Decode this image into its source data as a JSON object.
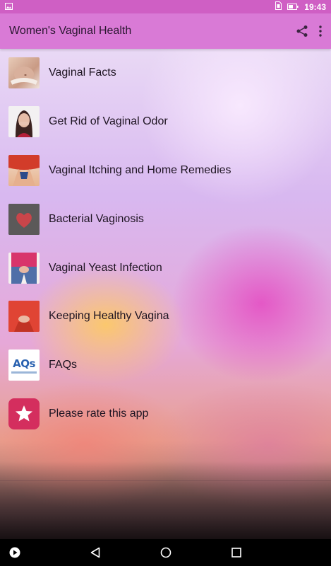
{
  "status_bar": {
    "time": "19:43",
    "icons": [
      "image-icon",
      "sim-icon",
      "battery-icon"
    ]
  },
  "app_bar": {
    "title": "Women's Vaginal Health",
    "actions": [
      "share-icon",
      "overflow-menu-icon"
    ],
    "color": "#d97ad6"
  },
  "menu": {
    "items": [
      {
        "label": "Vaginal Facts",
        "icon": "belly-thumbnail"
      },
      {
        "label": "Get Rid of Vaginal Odor",
        "icon": "woman-covering-face-thumbnail"
      },
      {
        "label": "Vaginal Itching and Home Remedies",
        "icon": "itching-thumbnail"
      },
      {
        "label": "Bacterial Vaginosis",
        "icon": "heart-thumbnail"
      },
      {
        "label": "Vaginal Yeast Infection",
        "icon": "jeans-thumbnail"
      },
      {
        "label": "Keeping Healthy Vagina",
        "icon": "red-dress-thumbnail"
      },
      {
        "label": "FAQs",
        "icon": "faqs-thumbnail",
        "thumb_text": "AQs"
      },
      {
        "label": "Please rate this app",
        "icon": "star-icon"
      }
    ]
  },
  "nav_bar": {
    "buttons": [
      "play-icon",
      "back-icon",
      "home-icon",
      "recents-icon"
    ]
  }
}
